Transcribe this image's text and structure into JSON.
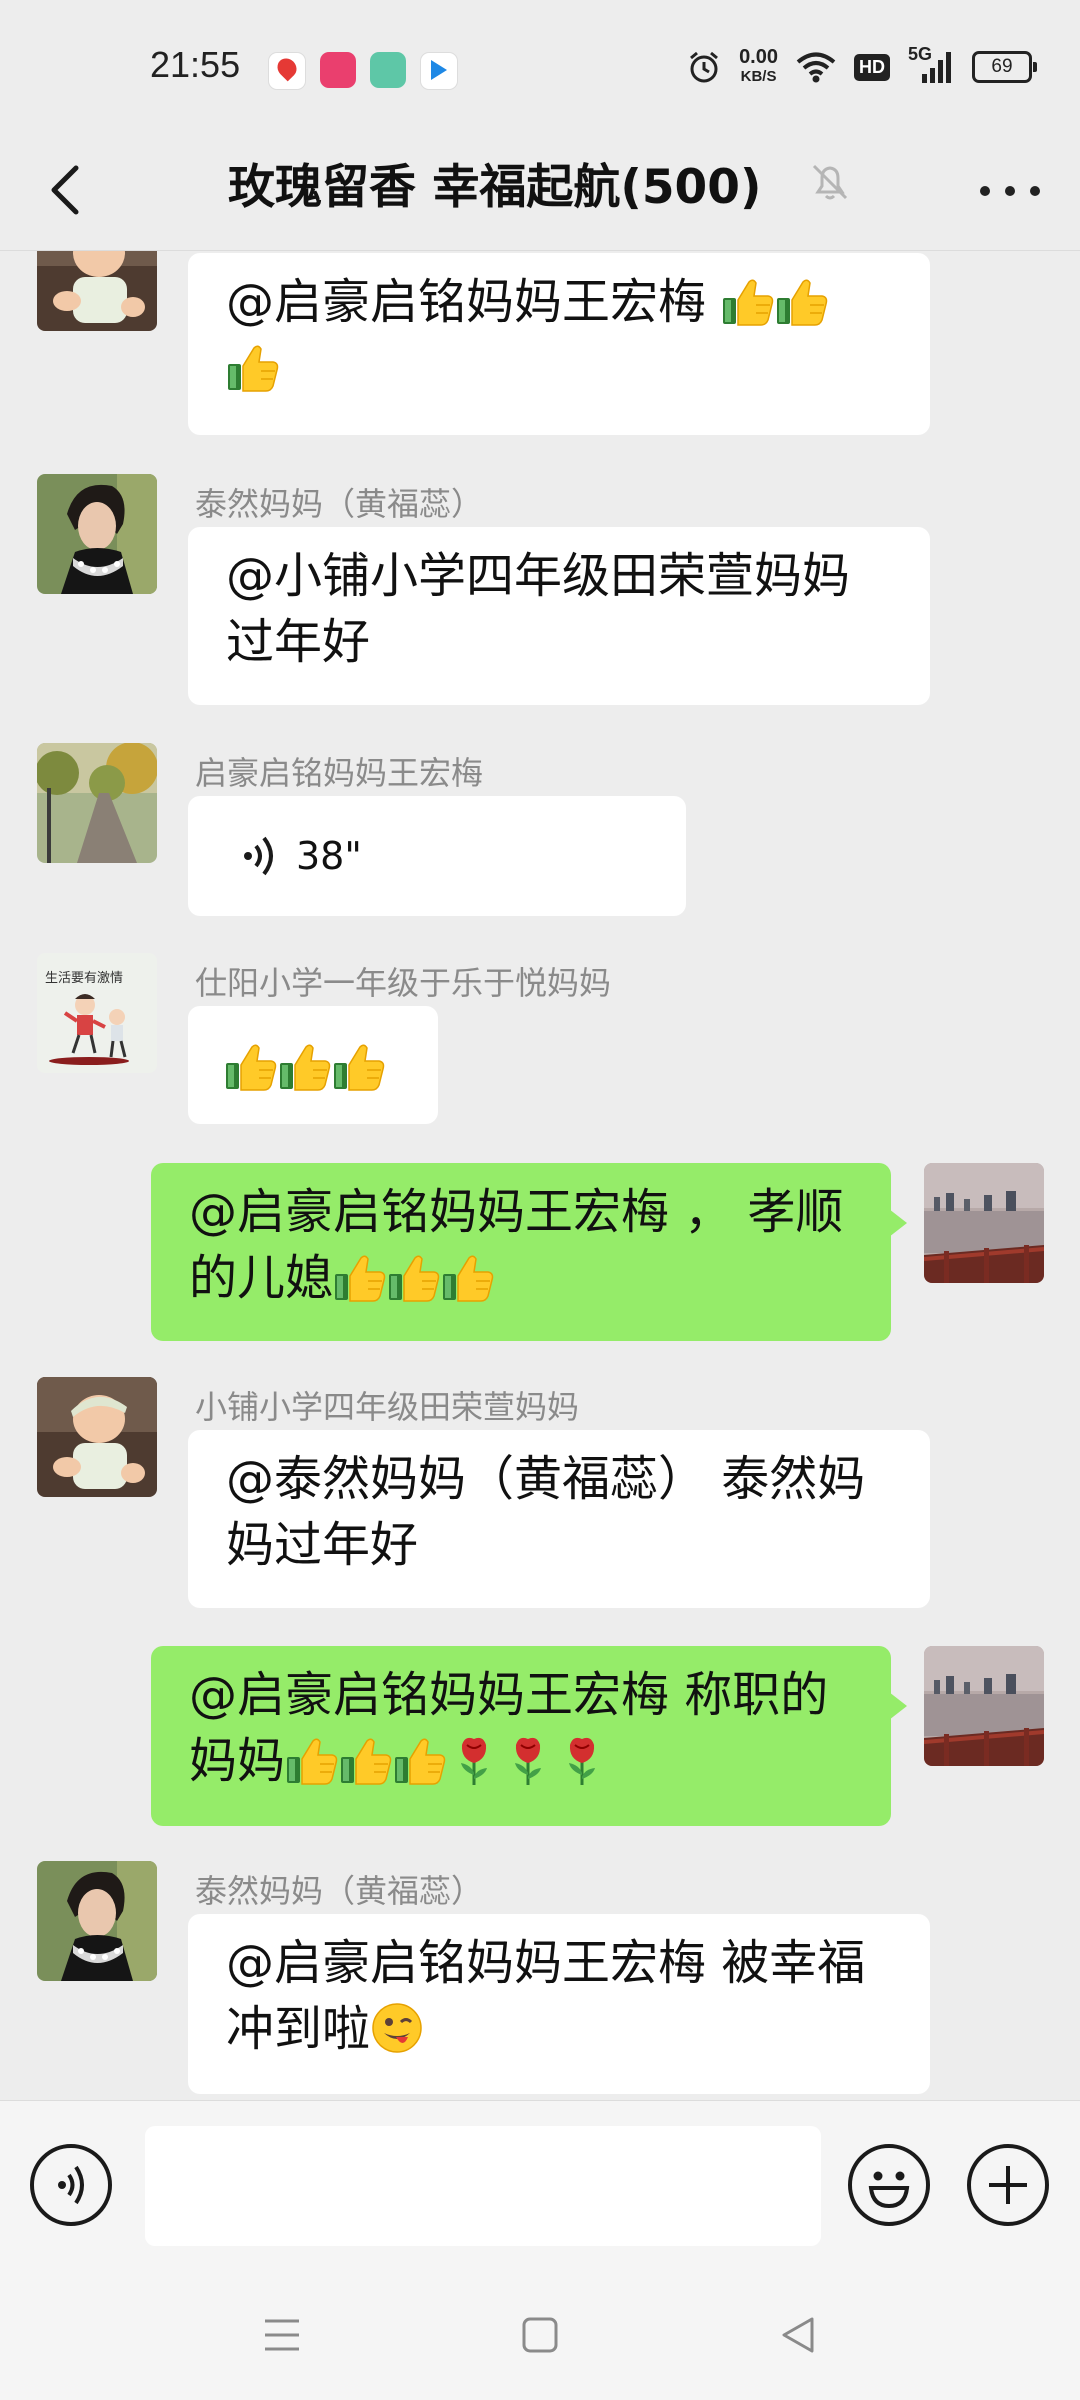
{
  "status": {
    "time": "21:55",
    "speed_value": "0.00",
    "speed_unit": "KB/S",
    "hd": "HD",
    "network": "5G",
    "battery": "69"
  },
  "header": {
    "title": "玫瑰留香  幸福起航(500)"
  },
  "messages": [
    {
      "text": "@启豪启铭妈妈王宏梅 "
    },
    {
      "sender": "泰然妈妈（黄福蕊）",
      "line1": "@小铺小学四年级田荣萱妈妈",
      "line2": "过年好"
    },
    {
      "sender": "启豪启铭妈妈王宏梅",
      "voice_duration": "38\""
    },
    {
      "sender": "仕阳小学一年级于乐于悦妈妈"
    },
    {
      "line1": "@启豪启铭妈妈王宏梅 ，  孝顺",
      "line2": "的儿媳"
    },
    {
      "sender": "小铺小学四年级田荣萱妈妈",
      "line1": "@泰然妈妈（黄福蕊）  泰然妈",
      "line2": "妈过年好"
    },
    {
      "line1": "@启豪启铭妈妈王宏梅  称职的",
      "line2": "妈妈"
    },
    {
      "sender": "泰然妈妈（黄福蕊）",
      "line1": "@启豪启铭妈妈王宏梅  被幸福",
      "line2": "冲到啦"
    }
  ],
  "avatar_caption": "生活要有激情",
  "colors": {
    "background": "#ededed",
    "incoming_bubble": "#ffffff",
    "outgoing_bubble": "#95ec69",
    "sender_text": "#8a8a8a"
  }
}
